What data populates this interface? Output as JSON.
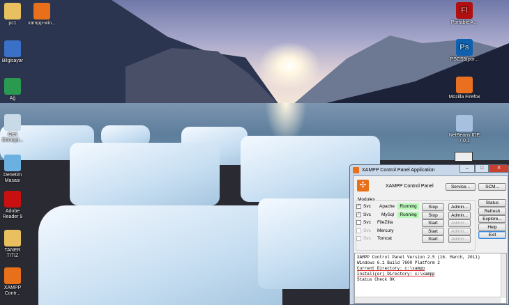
{
  "desktop": {
    "icons_left": [
      {
        "label": "pc1",
        "icon": "user-folder-icon"
      },
      {
        "label": "xampp-win...",
        "icon": "xampp-icon"
      },
      {
        "label": "Bilgisayar",
        "icon": "computer-icon"
      },
      {
        "label": "Ağ",
        "icon": "network-icon"
      },
      {
        "label": "Geri Dönüşü...",
        "icon": "recycle-bin-icon"
      },
      {
        "label": "Denetim Masası",
        "icon": "control-panel-icon"
      },
      {
        "label": "Adobe Reader 9",
        "icon": "adobe-reader-icon"
      },
      {
        "label": "TANER TITIZ",
        "icon": "folder-icon"
      },
      {
        "label": "XAMPP Contr...",
        "icon": "xampp-icon"
      }
    ],
    "icons_right": [
      {
        "label": "Portable A...",
        "icon": "flash-icon",
        "glyph": "Fl"
      },
      {
        "label": "PSCS5(por...",
        "icon": "photoshop-icon",
        "glyph": "Ps"
      },
      {
        "label": "Mozilla Firefox",
        "icon": "firefox-icon"
      },
      {
        "label": "NetBeans IDE 7.0.1",
        "icon": "netbeans-icon"
      }
    ]
  },
  "window": {
    "title": "XAMPP Control Panel Application",
    "controls": [
      "–",
      "□",
      "✕"
    ],
    "header": "XAMPP Control Panel",
    "service_btn": "Service...",
    "scm_btn": "SCM...",
    "modules_label": "Modules",
    "svc_label": "Svc",
    "modules": [
      {
        "name": "Apache",
        "checked": true,
        "status": "Running",
        "action": "Stop",
        "admin": "Admin...",
        "enabled": true
      },
      {
        "name": "MySql",
        "checked": true,
        "status": "Running",
        "action": "Stop",
        "admin": "Admin...",
        "enabled": true
      },
      {
        "name": "FileZilla",
        "checked": false,
        "status": "",
        "action": "Start",
        "admin": "Admin...",
        "enabled": true
      },
      {
        "name": "Mercury",
        "checked": false,
        "status": "",
        "action": "Start",
        "admin": "Admin...",
        "enabled": false
      },
      {
        "name": "Tomcat",
        "checked": false,
        "status": "",
        "action": "Start",
        "admin": "Admin...",
        "enabled": false
      }
    ],
    "side_buttons": [
      "Status",
      "Refresh",
      "Explore...",
      "Help",
      "Exit"
    ],
    "log": [
      "XAMPP Control Panel Version 2.5 (16. March, 2011)",
      "Windows 6.1 Build 7600 Platform 2",
      "Current Directory: c:\\xampp",
      "Install(er) Directory: c:\\xampp",
      "Status Check OK"
    ],
    "accent": "#e8701a",
    "running_color": "#b8f8b8"
  }
}
